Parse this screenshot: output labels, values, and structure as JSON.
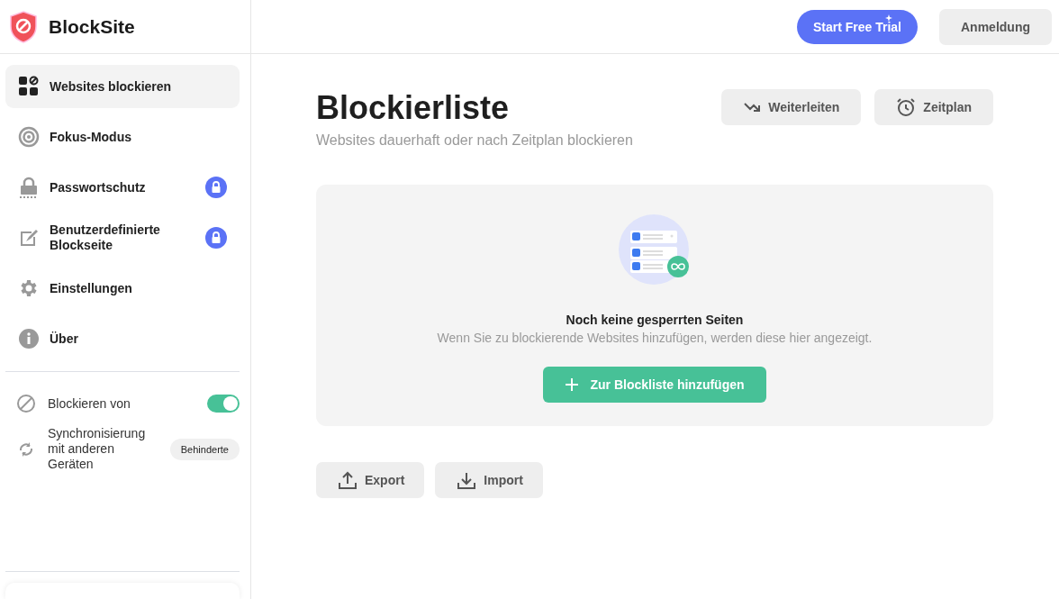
{
  "brand": {
    "name": "BlockSite"
  },
  "header": {
    "trial_button": "Start Free Trial",
    "login_button": "Anmeldung"
  },
  "sidebar": {
    "items": [
      {
        "label": "Websites blockieren",
        "selected": true,
        "locked": false
      },
      {
        "label": "Fokus-Modus",
        "selected": false,
        "locked": false
      },
      {
        "label": "Passwortschutz",
        "selected": false,
        "locked": true
      },
      {
        "label": "Benutzerdefinierte Blockseite",
        "selected": false,
        "locked": true
      },
      {
        "label": "Einstellungen",
        "selected": false,
        "locked": false
      },
      {
        "label": "Über",
        "selected": false,
        "locked": false
      }
    ],
    "settings": [
      {
        "kind": "toggle",
        "label": "Blockieren von",
        "on": true
      },
      {
        "kind": "badge",
        "label": "Synchronisierung mit anderen Geräten",
        "badge": "Behinderte"
      }
    ]
  },
  "main": {
    "title": "Blockierliste",
    "subtitle": "Websites dauerhaft oder nach Zeitplan blockieren",
    "actions": [
      {
        "label": "Weiterleiten"
      },
      {
        "label": "Zeitplan"
      }
    ],
    "empty": {
      "title": "Noch keine gesperrten Seiten",
      "text": "Wenn Sie zu blockierende Websites hinzufügen, werden diese hier angezeigt.",
      "button": "Zur Blockliste hinzufügen"
    },
    "transfer": [
      {
        "label": "Export"
      },
      {
        "label": "Import"
      }
    ]
  }
}
